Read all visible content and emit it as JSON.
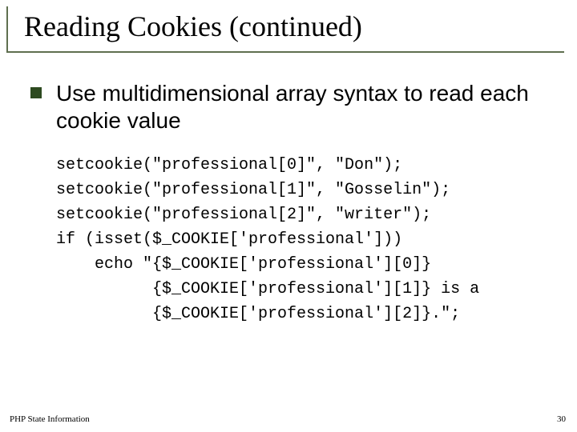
{
  "title": "Reading Cookies (continued)",
  "bullet": "Use multidimensional array syntax to read each cookie value",
  "code": "setcookie(\"professional[0]\", \"Don\");\nsetcookie(\"professional[1]\", \"Gosselin\");\nsetcookie(\"professional[2]\", \"writer\");\nif (isset($_COOKIE['professional']))\n    echo \"{$_COOKIE['professional'][0]}\n          {$_COOKIE['professional'][1]} is a\n          {$_COOKIE['professional'][2]}.\";",
  "footer_left": "PHP State Information",
  "footer_right": "30"
}
